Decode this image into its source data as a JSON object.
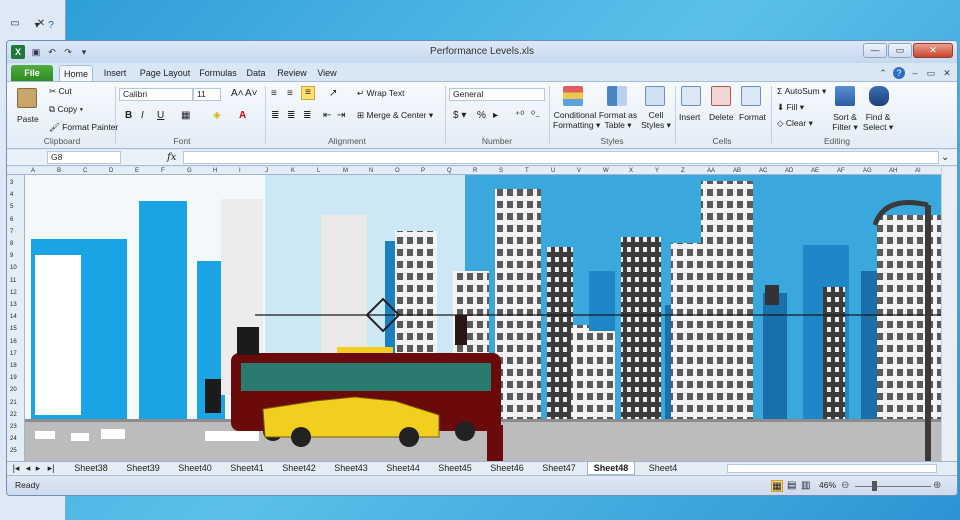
{
  "background_window": {
    "close_glyph": "✕",
    "minimize_glyph": "▭",
    "help_glyph": "?"
  },
  "window": {
    "title": "Performance Levels.xls",
    "controls": {
      "minimize": "—",
      "maximize": "▭",
      "close": "✕"
    }
  },
  "tabs": [
    "File",
    "Home",
    "Insert",
    "Page Layout",
    "Formulas",
    "Data",
    "Review",
    "View"
  ],
  "ribbon": {
    "clipboard": {
      "paste": "Paste",
      "cut": "Cut",
      "copy": "Copy ▾",
      "format_painter": "Format Painter",
      "group": "Clipboard"
    },
    "font": {
      "name": "Calibri",
      "size": "11",
      "group": "Font",
      "bold": "B",
      "italic": "I",
      "underline": "U"
    },
    "alignment": {
      "wrap": "Wrap Text",
      "merge": "Merge & Center ▾",
      "group": "Alignment"
    },
    "number": {
      "format": "General",
      "currency": "$ ▾",
      "percent": "%",
      "comma": "▸",
      "group": "Number"
    },
    "styles": {
      "conditional": [
        "Conditional",
        "Formatting ▾"
      ],
      "format_table": [
        "Format as",
        "Table ▾"
      ],
      "cell_styles": [
        "Cell",
        "Styles ▾"
      ],
      "group": "Styles"
    },
    "cells": {
      "insert": "Insert",
      "delete": "Delete",
      "format": "Format",
      "group": "Cells"
    },
    "editing": {
      "autosum": "AutoSum ▾",
      "fill": "Fill ▾",
      "clear": "Clear ▾",
      "sort": [
        "Sort &",
        "Filter ▾"
      ],
      "find": [
        "Find &",
        "Select ▾"
      ],
      "group": "Editing"
    }
  },
  "formula_bar": {
    "name_box": "G8",
    "fx": "fx",
    "value": ""
  },
  "columns": [
    "A",
    "B",
    "C",
    "D",
    "E",
    "F",
    "G",
    "H",
    "I",
    "J",
    "K",
    "L",
    "M",
    "N",
    "O",
    "P",
    "Q",
    "R",
    "S",
    "T",
    "U",
    "V",
    "W",
    "X",
    "Y",
    "Z",
    "AA",
    "AB",
    "AC",
    "AD",
    "AE",
    "AF",
    "AG",
    "AH",
    "AI"
  ],
  "rows": [
    "3",
    "4",
    "5",
    "6",
    "7",
    "8",
    "9",
    "10",
    "11",
    "12",
    "13",
    "14",
    "15",
    "16",
    "17",
    "18",
    "19",
    "20",
    "21",
    "22",
    "23",
    "24",
    "25"
  ],
  "sheets": [
    "Sheet38",
    "Sheet39",
    "Sheet40",
    "Sheet41",
    "Sheet42",
    "Sheet43",
    "Sheet44",
    "Sheet45",
    "Sheet46",
    "Sheet47",
    "Sheet48",
    "Sheet4"
  ],
  "active_sheet": "Sheet48",
  "status": {
    "ready": "Ready",
    "zoom": "46%",
    "zoom_fraction": 0.46
  },
  "colors": {
    "sky": "#3aa8dc",
    "building_blue": "#1aa4e6",
    "bus": "#6b0a0a",
    "car": "#f2cf1f",
    "ground": "#bcbcbc"
  }
}
